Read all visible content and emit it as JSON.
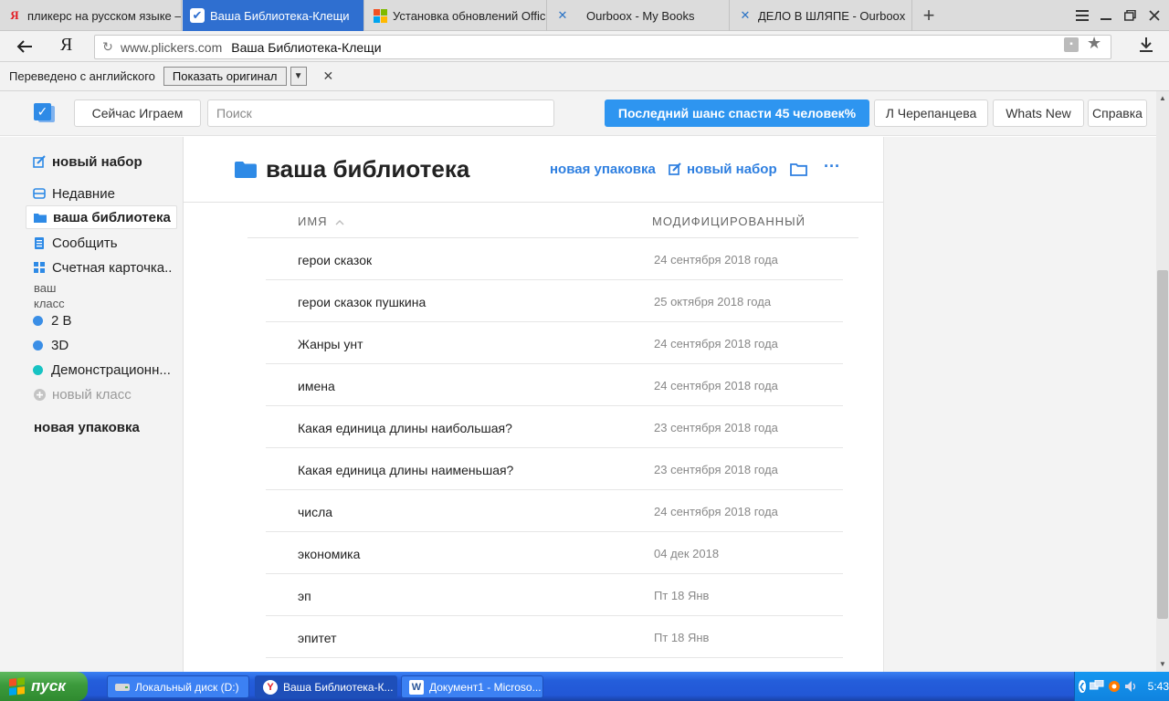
{
  "browser": {
    "tabs": [
      {
        "title": "пликерс на русском языке –",
        "icon": "yandex-icon",
        "active": false
      },
      {
        "title": "Ваша Библиотека-Клещи",
        "icon": "plickers-icon",
        "active": true
      },
      {
        "title": "Установка обновлений Office",
        "icon": "microsoft-icon",
        "active": false
      },
      {
        "title": "Ourboox - My Books",
        "icon": "ourboox-icon",
        "active": false
      },
      {
        "title": "ДЕЛО В ШЛЯПЕ - Ourboox",
        "icon": "ourboox-icon",
        "active": false
      }
    ],
    "new_tab": "+",
    "address": {
      "domain": "www.plickers.com",
      "page_title": "Ваша Библиотека-Клещи"
    },
    "yandex_logo": "Я"
  },
  "translate_bar": {
    "label": "Переведено с английского",
    "show_original": "Показать оригинал",
    "close": "✕"
  },
  "header": {
    "now_playing": "Сейчас Играем",
    "search_placeholder": "Поиск",
    "promo": "Последний шанс спасти 45 человек%",
    "user": "Л Черепанцева",
    "whats_new": "Whats New",
    "help": "Справка"
  },
  "sidebar": {
    "new_set": "новый набор",
    "recent": "Недавние",
    "library": "ваша библиотека",
    "report": "Сообщить",
    "scoresheet": "Счетная карточка..",
    "classes_label_1": "ваш",
    "classes_label_2": "класс",
    "classes": [
      {
        "name": "2 В",
        "color": "#3a8ee6"
      },
      {
        "name": "3D",
        "color": "#3a8ee6"
      },
      {
        "name": "Демонстрационн...",
        "color": "#17c3c3"
      }
    ],
    "new_class": "новый класс",
    "new_pack": "новая упаковка"
  },
  "main": {
    "title": "ваша библиотека",
    "new_pack": "новая упаковка",
    "new_set": "новый набор",
    "more": "···",
    "col_name": "ИМЯ",
    "col_modified": "МОДИФИЦИРОВАННЫЙ",
    "rows": [
      {
        "name": "герои сказок",
        "date": "24 сентября 2018 года"
      },
      {
        "name": "герои сказок пушкина",
        "date": "25 октября 2018 года"
      },
      {
        "name": "Жанры унт",
        "date": "24 сентября 2018 года"
      },
      {
        "name": "имена",
        "date": "24 сентября 2018 года"
      },
      {
        "name": "Какая единица длины наибольшая?",
        "date": "23 сентября 2018 года"
      },
      {
        "name": "Какая единица длины наименьшая?",
        "date": "23 сентября 2018 года"
      },
      {
        "name": "числа",
        "date": "24 сентября 2018 года"
      },
      {
        "name": "экономика",
        "date": "04 дек 2018"
      },
      {
        "name": "эп",
        "date": "Пт 18 Янв"
      },
      {
        "name": "эпитет",
        "date": "Пт 18 Янв"
      }
    ]
  },
  "taskbar": {
    "start": "пуск",
    "items": [
      {
        "label": "Локальный диск (D:)"
      },
      {
        "label": "Ваша Библиотека-К..."
      },
      {
        "label": "Документ1 - Microso..."
      }
    ],
    "clock": "5:43"
  },
  "colors": {
    "accent": "#2e8ae6",
    "promo": "#2e95f0",
    "tab_active": "#2f6fd0",
    "taskbar": "#245edb",
    "start": "#3c9a3c"
  }
}
